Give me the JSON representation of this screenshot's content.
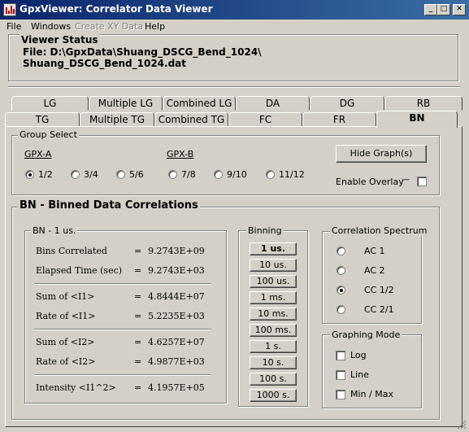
{
  "window": {
    "title": "GpxViewer: Correlator Data Viewer",
    "controls": {
      "minimize": "_",
      "maximize": "□",
      "close": "✕"
    }
  },
  "menu": {
    "items": [
      "File",
      "Windows",
      "Create XY Data",
      "Help"
    ]
  },
  "viewer_status": {
    "title": "Viewer  Status",
    "line1": "File: D:\\GpxData\\Shuang_DSCG_Bend_1024\\",
    "line2": "Shuang_DSCG_Bend_1024.dat"
  },
  "tabs": {
    "back_row": [
      "LG",
      "Multiple LG",
      "Combined LG",
      "DA",
      "DG",
      "RB"
    ],
    "front_row": [
      "TG",
      "Multiple TG",
      "Combined TG",
      "FC",
      "FR",
      "BN"
    ],
    "active": "BN"
  },
  "group_select": {
    "title": "Group Select",
    "gpx_a_label": "GPX-A",
    "gpx_b_label": "GPX-B",
    "options": [
      "1/2",
      "3/4",
      "5/6",
      "7/8",
      "9/10",
      "11/12"
    ],
    "selected": "1/2",
    "hide_graphs_label": "Hide Graph(s)",
    "enable_overlay_label": "Enable Overlay",
    "overlay_dash": "----",
    "overlay_checked": false
  },
  "bn_section": {
    "title": "BN - Binned Data Correlations",
    "stats_title": "BN - 1 us.",
    "stats": {
      "bins_correlated": {
        "label": "Bins Correlated",
        "eq": "=",
        "value": "9.2743E+09"
      },
      "elapsed_time": {
        "label": "Elapsed Time (sec)",
        "eq": "=",
        "value": "9.2743E+03"
      },
      "sum_i1": {
        "label": "Sum of <I1>",
        "eq": "=",
        "value": "4.8444E+07"
      },
      "rate_i1": {
        "label": "Rate of <I1>",
        "eq": "=",
        "value": "5.2235E+03"
      },
      "sum_i2": {
        "label": "Sum of <I2>",
        "eq": "=",
        "value": "4.6257E+07"
      },
      "rate_i2": {
        "label": "Rate of <I2>",
        "eq": "=",
        "value": "4.9877E+03"
      },
      "intensity": {
        "label": "Intensity <I1^2>",
        "eq": "=",
        "value": "4.1957E+05"
      }
    },
    "binning_title": "Binning",
    "binning": [
      "1 us.",
      "10 us.",
      "100 us.",
      "1 ms.",
      "10 ms.",
      "100 ms.",
      "1 s.",
      "10 s.",
      "100 s.",
      "1000 s."
    ],
    "binning_selected": "1 us.",
    "corr_title": "Correlation Spectrum",
    "corr_options": [
      "AC 1",
      "AC 2",
      "CC 1/2",
      "CC 2/1"
    ],
    "corr_selected": "CC 1/2",
    "graph_title": "Graphing  Mode",
    "graph_options": [
      "Log",
      "Line",
      "Min / Max"
    ]
  },
  "colors": {
    "title_bar_start": "#0a246a",
    "title_bar_end": "#3a6ea5",
    "face": "#d4d0c8"
  }
}
